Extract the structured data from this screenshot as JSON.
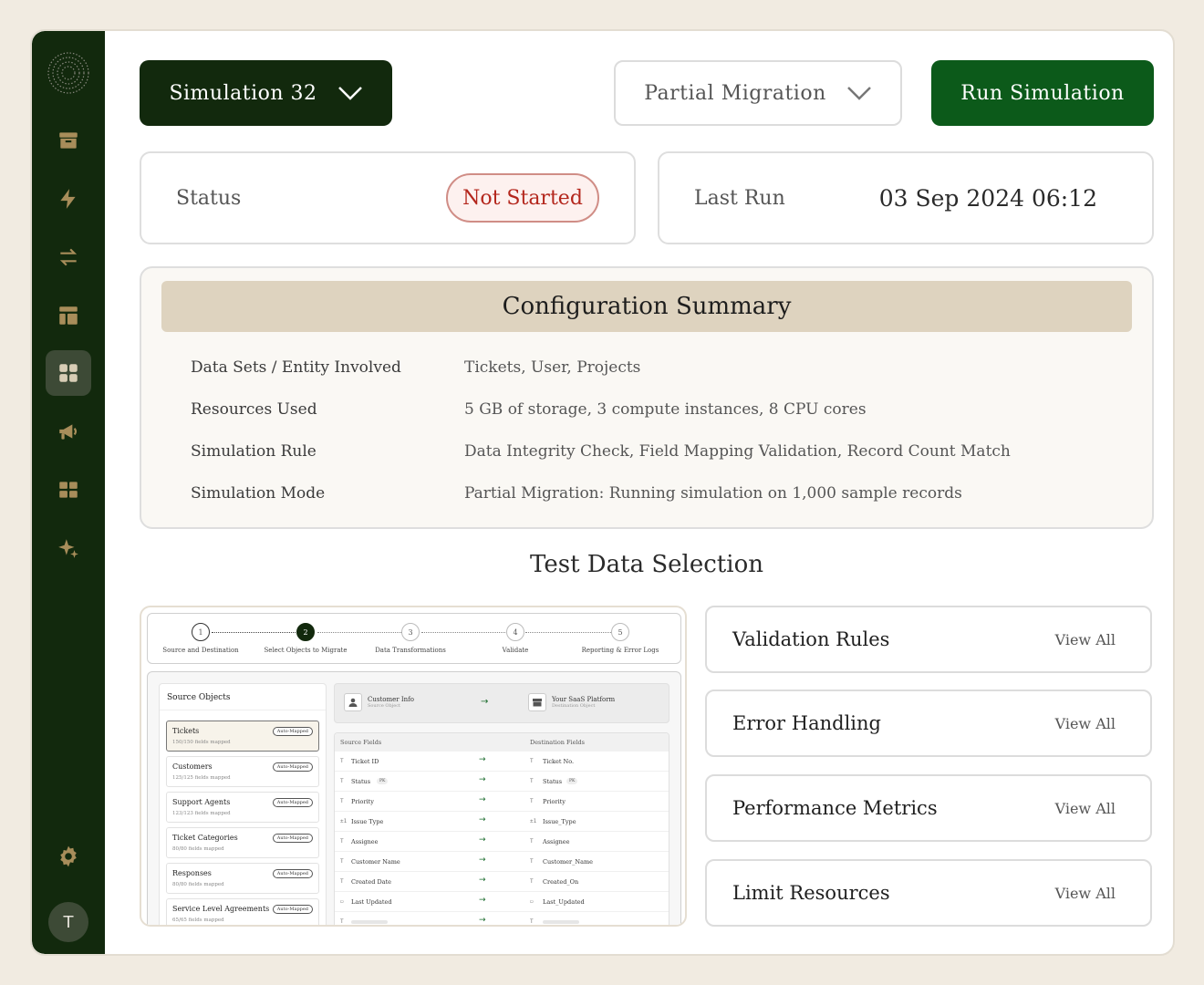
{
  "header": {
    "simulation_label": "Simulation 32",
    "mode_label": "Partial Migration",
    "run_label": "Run Simulation"
  },
  "status": {
    "label": "Status",
    "value": "Not Started"
  },
  "last_run": {
    "label": "Last Run",
    "value": "03 Sep 2024 06:12"
  },
  "config": {
    "title": "Configuration Summary",
    "rows": [
      {
        "key": "Data Sets / Entity Involved",
        "value": "Tickets, User, Projects"
      },
      {
        "key": "Resources Used",
        "value": "5 GB of storage, 3 compute instances, 8 CPU cores"
      },
      {
        "key": "Simulation Rule",
        "value": "Data Integrity Check, Field Mapping Validation, Record Count Match"
      },
      {
        "key": "Simulation Mode",
        "value": "Partial Migration: Running simulation on 1,000 sample records"
      }
    ]
  },
  "test_data": {
    "title": "Test Data Selection",
    "steps": [
      {
        "num": "1",
        "label": "Source and Destination"
      },
      {
        "num": "2",
        "label": "Select Objects to Migrate"
      },
      {
        "num": "3",
        "label": "Data Transformations"
      },
      {
        "num": "4",
        "label": "Validate"
      },
      {
        "num": "5",
        "label": "Reporting & Error Logs"
      }
    ],
    "source_title": "Source Objects",
    "source_objects": [
      {
        "name": "Tickets",
        "sub": "150/150 fields mapped",
        "tag": "Auto-Mapped"
      },
      {
        "name": "Customers",
        "sub": "125/125 fields mapped",
        "tag": "Auto-Mapped"
      },
      {
        "name": "Support Agents",
        "sub": "123/123 fields mapped",
        "tag": "Auto-Mapped"
      },
      {
        "name": "Ticket Categories",
        "sub": "80/80 fields mapped",
        "tag": "Auto-Mapped"
      },
      {
        "name": "Responses",
        "sub": "80/80 fields mapped",
        "tag": "Auto-Mapped"
      },
      {
        "name": "Service Level Agreements",
        "sub": "65/65 fields mapped",
        "tag": "Auto-Mapped"
      }
    ],
    "source_obj": {
      "name": "Customer Info",
      "sub": "Source Object"
    },
    "dest_obj": {
      "name": "Your SaaS Platform",
      "sub": "Destination Object"
    },
    "source_fields_label": "Source Fields",
    "dest_fields_label": "Destination Fields",
    "pk_label": "PK",
    "field_rows": [
      {
        "src_icon": "T",
        "src": "Ticket ID",
        "dst_icon": "T",
        "dst": "Ticket No."
      },
      {
        "src_icon": "T",
        "src": "Status",
        "dst_icon": "T",
        "dst": "Status"
      },
      {
        "src_icon": "T",
        "src": "Priority",
        "dst_icon": "T",
        "dst": "Priority"
      },
      {
        "src_icon": "±1",
        "src": "Issue Type",
        "dst_icon": "±1",
        "dst": "Issue_Type"
      },
      {
        "src_icon": "T",
        "src": "Assignee",
        "dst_icon": "T",
        "dst": "Assignee"
      },
      {
        "src_icon": "T",
        "src": "Customer Name",
        "dst_icon": "T",
        "dst": "Customer_Name"
      },
      {
        "src_icon": "T",
        "src": "Created Date",
        "dst_icon": "T",
        "dst": "Created_On"
      },
      {
        "src_icon": "▭",
        "src": "Last Updated",
        "dst_icon": "▭",
        "dst": "Last_Updated"
      },
      {
        "src_icon": "T",
        "src": "",
        "dst_icon": "T",
        "dst": ""
      }
    ],
    "arrow": "→"
  },
  "side_cards": [
    {
      "title": "Validation Rules",
      "link": "View All"
    },
    {
      "title": "Error Handling",
      "link": "View All"
    },
    {
      "title": "Performance Metrics",
      "link": "View All"
    },
    {
      "title": "Limit Resources",
      "link": "View All"
    }
  ],
  "user": {
    "initial": "T"
  },
  "nav_icons": [
    "archive-icon",
    "bolt-icon",
    "transfer-icon",
    "layout-icon",
    "dashboard-icon",
    "megaphone-icon",
    "table-icon",
    "sparkle-icon",
    "gear-icon"
  ],
  "colors": {
    "sidebar": "#12290d",
    "accent_green": "#0c5a1a",
    "icon_gold": "#a88d5a",
    "status_red": "#b4271d",
    "config_header": "#ded3bf"
  }
}
